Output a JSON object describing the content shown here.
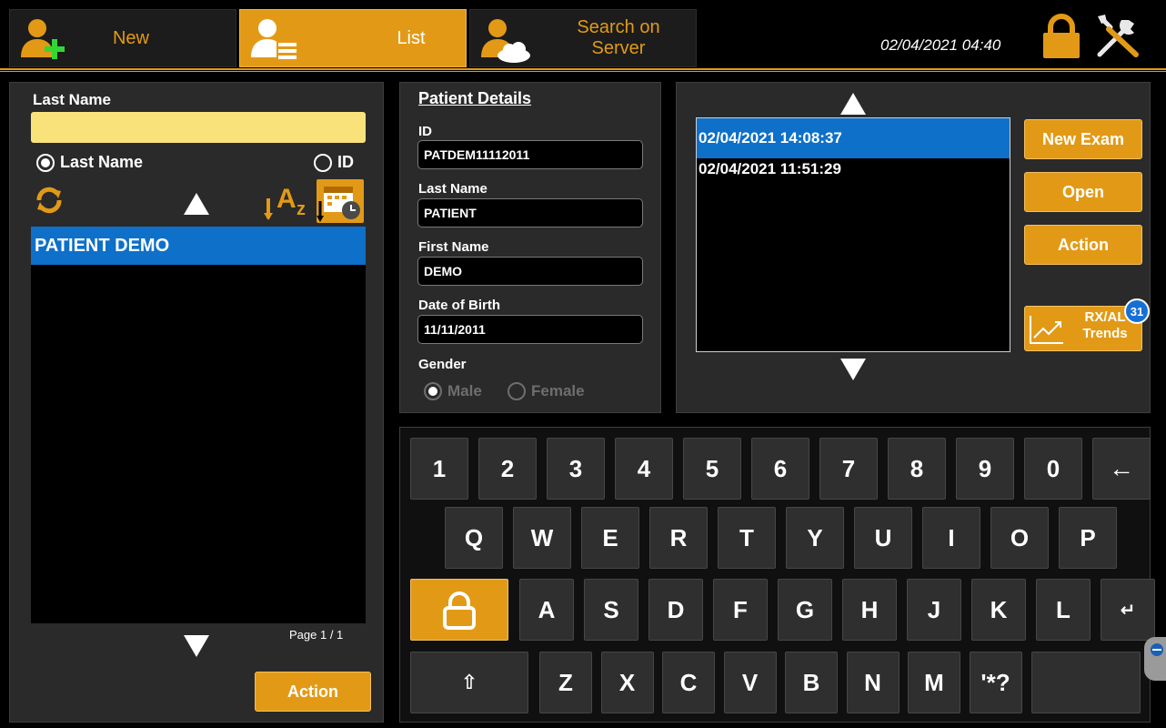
{
  "colors": {
    "accent": "#e29a16",
    "selection": "#0e70c8",
    "input_highlight": "#fae27b",
    "badge": "#1670d4"
  },
  "header": {
    "tabs": [
      {
        "label": "New",
        "icon": "add-patient-icon"
      },
      {
        "label": "List",
        "icon": "patient-list-icon"
      },
      {
        "label": "Search on Server",
        "icon": "cloud-search-icon"
      }
    ],
    "active_tab": "List",
    "datetime": "02/04/2021 04:40",
    "icons": [
      "lock-icon",
      "tools-icon"
    ]
  },
  "search": {
    "label": "Last Name",
    "value": "",
    "radio_last_name": "Last Name",
    "radio_id": "ID",
    "selected_mode": "Last Name",
    "icons": [
      "refresh-icon",
      "sort-alpha-icon",
      "sort-date-icon",
      "arrow-up-icon",
      "arrow-down-icon"
    ]
  },
  "patients": {
    "items": [
      "PATIENT DEMO"
    ],
    "selected": "PATIENT DEMO",
    "page_text": "Page  1  /  1",
    "action_label": "Action"
  },
  "details": {
    "title": "Patient Details",
    "id_label": "ID",
    "id_value": "PATDEM11112011",
    "last_name_label": "Last Name",
    "last_name_value": "PATIENT",
    "first_name_label": "First Name",
    "first_name_value": "DEMO",
    "dob_label": "Date of Birth",
    "dob_value": "11/11/2011",
    "gender_label": "Gender",
    "gender_male": "Male",
    "gender_female": "Female",
    "gender_selected": "Male"
  },
  "exams": {
    "items": [
      "02/04/2021 14:08:37",
      "02/04/2021 11:51:29"
    ],
    "selected": "02/04/2021 14:08:37",
    "new_exam_label": "New Exam",
    "open_label": "Open",
    "action_label": "Action",
    "trends_line1": "RX/AL",
    "trends_line2": "Trends",
    "trends_badge": "31"
  },
  "keyboard": {
    "row1": [
      "1",
      "2",
      "3",
      "4",
      "5",
      "6",
      "7",
      "8",
      "9",
      "0",
      "←"
    ],
    "row2": [
      "Q",
      "W",
      "E",
      "R",
      "T",
      "Y",
      "U",
      "I",
      "O",
      "P"
    ],
    "row3": [
      "A",
      "S",
      "D",
      "F",
      "G",
      "H",
      "J",
      "K",
      "L",
      "↵"
    ],
    "row4": [
      "⇧",
      "Z",
      "X",
      "C",
      "V",
      "B",
      "N",
      "M",
      "'*?",
      ""
    ],
    "caps_lock_icon": "lock-icon"
  }
}
